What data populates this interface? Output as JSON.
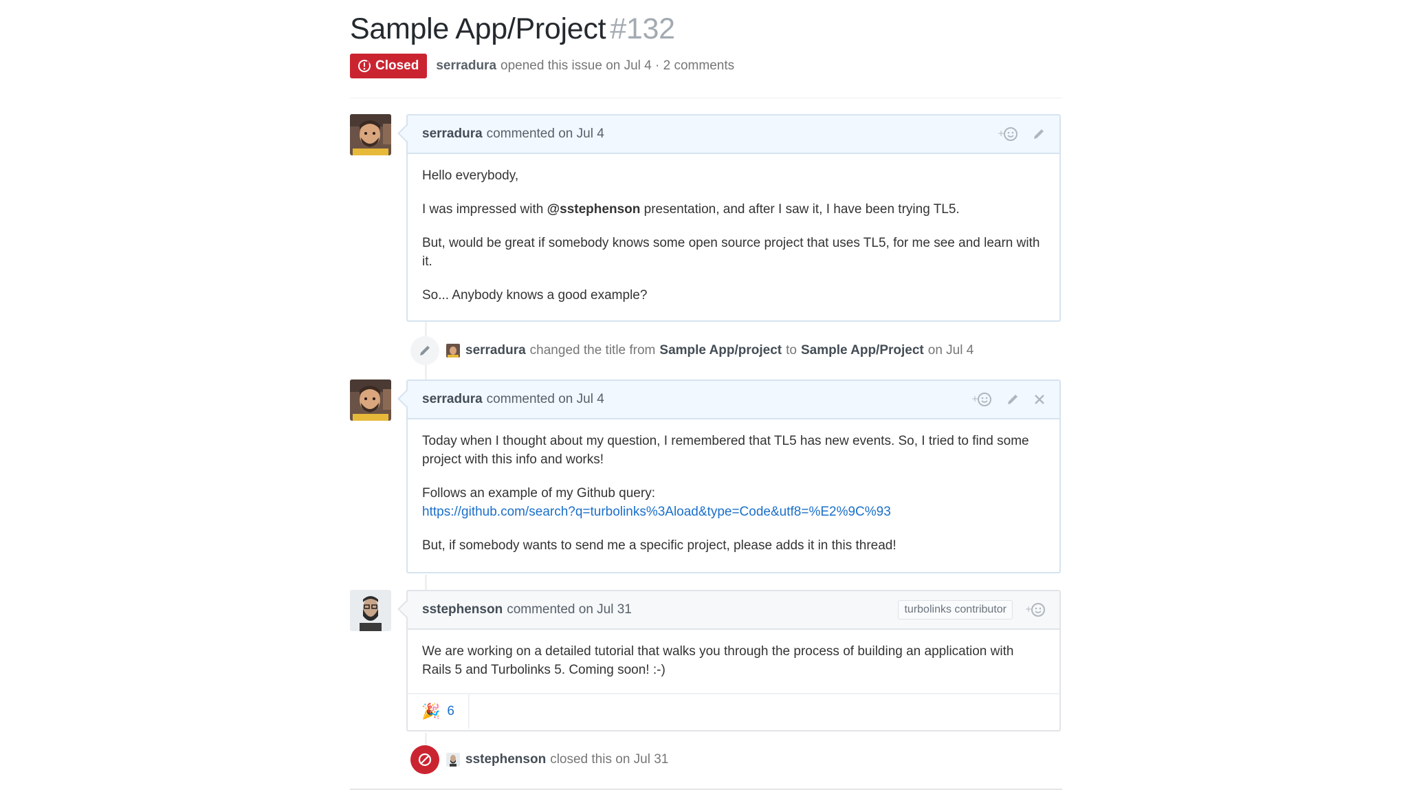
{
  "issue": {
    "title": "Sample App/Project",
    "number": "#132",
    "state": "Closed",
    "author": "serradura",
    "opened_text": "opened this issue on Jul 4 · 2 comments"
  },
  "comments": [
    {
      "author": "serradura",
      "meta": "commented on Jul 4",
      "body": {
        "p1": "Hello everybody,",
        "p2_before": "I was impressed with ",
        "p2_mention": "@sstephenson",
        "p2_after": " presentation, and after I saw it, I have been trying TL5.",
        "p3": "But, would be great if somebody knows some open source project that uses TL5, for me see and learn with it.",
        "p4": "So... Anybody knows a good example?"
      }
    },
    {
      "author": "serradura",
      "meta": "commented on Jul 4",
      "body": {
        "p1": "Today when I thought about my question, I remembered that TL5 has new events. So, I tried to find some project with this info and works!",
        "p2": "Follows an example of my Github query:",
        "link": "https://github.com/search?q=turbolinks%3Aload&type=Code&utf8=%E2%9C%93",
        "p3": "But, if somebody wants to send me a specific project, please adds it in this thread!"
      }
    },
    {
      "author": "sstephenson",
      "meta": "commented on Jul 31",
      "badge": "turbolinks contributor",
      "body": {
        "p1": "We are working on a detailed tutorial that walks you through the process of building an application with Rails 5 and Turbolinks 5. Coming soon! :-)"
      },
      "reaction_count": "6"
    }
  ],
  "events": {
    "rename": {
      "actor": "serradura",
      "text1": "changed the title from",
      "from": "Sample App/project",
      "text2": "to",
      "to": "Sample App/Project",
      "text3": "on Jul 4"
    },
    "closed": {
      "actor": "sstephenson",
      "text": "closed this on Jul 31"
    }
  },
  "icons": {
    "issue_closed": "issue-closed-icon",
    "add_reaction": "smiley-icon",
    "edit": "pencil-icon",
    "delete": "x-icon",
    "closed_event": "circle-slash-icon",
    "reaction_emoji": "tada-icon"
  },
  "colors": {
    "closed_red": "#cb2431",
    "link_blue": "#1a6fc9",
    "comment_border_blue": "#d6e3f0",
    "comment_header_blue": "#f1f8ff"
  }
}
